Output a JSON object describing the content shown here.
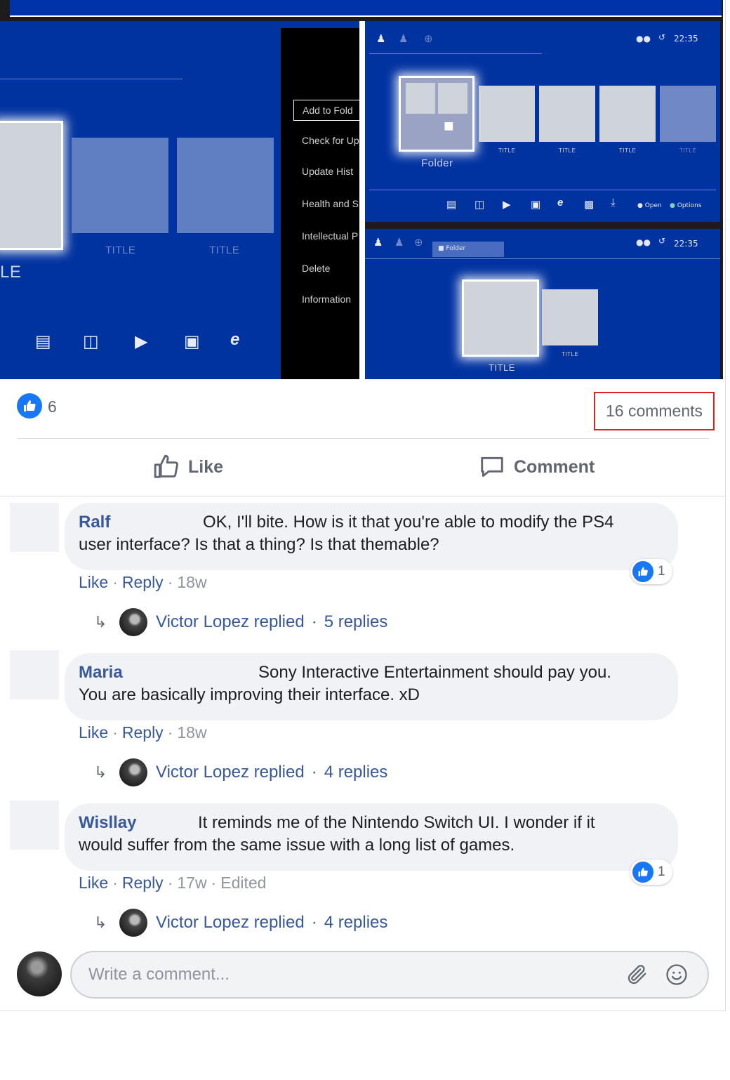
{
  "post_image": {
    "left": {
      "tile_labels": [
        "TITLE",
        "TITLE",
        "LE"
      ],
      "menu": [
        "Add to Fold",
        "Check for Up",
        "Update Hist",
        "Health and S",
        "Intellectual P",
        "Delete",
        "Information"
      ]
    },
    "top_right": {
      "time": "22:35",
      "folder_label": "Folder",
      "tile_labels": [
        "TITLE",
        "TITLE",
        "TITLE",
        "TITLE"
      ],
      "legend": [
        "Open",
        "Options"
      ]
    },
    "bottom_right": {
      "time": "22:35",
      "folder_tab": "Folder",
      "tile_labels": [
        "TITLE",
        "TITLE"
      ]
    }
  },
  "reactions": {
    "like_count": "6",
    "comments_count": "16 comments"
  },
  "actions": {
    "like_label": "Like",
    "comment_label": "Comment"
  },
  "comments": [
    {
      "author": "Ralf",
      "text_line1": "OK, I'll bite. How is it that you're able to modify the PS4",
      "text_line2": "user interface? Is that a thing? Is that themable?",
      "like": "Like",
      "reply": "Reply",
      "time": "18w",
      "edited": "",
      "reaction_count": "1",
      "replied_by": "Victor Lopez replied",
      "replies": "5 replies"
    },
    {
      "author": "Maria",
      "text_line1": "Sony Interactive Entertainment should pay you.",
      "text_line2": "You are basically improving their interface. xD",
      "like": "Like",
      "reply": "Reply",
      "time": "18w",
      "edited": "",
      "reaction_count": "",
      "replied_by": "Victor Lopez replied",
      "replies": "4 replies"
    },
    {
      "author": "Wisllay",
      "text_line1": "It reminds me of the Nintendo Switch UI. I wonder if it",
      "text_line2": "would suffer from the same issue with a long list of games.",
      "like": "Like",
      "reply": "Reply",
      "time": "17w",
      "edited": "Edited",
      "reaction_count": "1",
      "replied_by": "Victor Lopez replied",
      "replies": "4 replies"
    }
  ],
  "composer": {
    "placeholder": "Write a comment..."
  },
  "colors": {
    "facebook_blue": "#1877f2",
    "link_blue": "#385898",
    "ps_blue": "#0032a0",
    "highlight_red": "#e02020"
  }
}
